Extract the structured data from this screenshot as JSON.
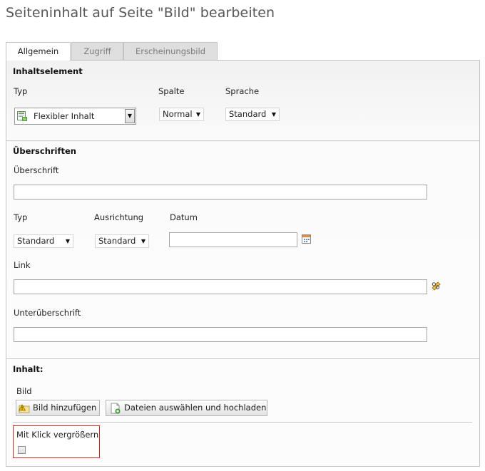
{
  "page": {
    "title": "Seiteninhalt auf Seite \"Bild\" bearbeiten"
  },
  "tabs": [
    {
      "label": "Allgemein",
      "active": true
    },
    {
      "label": "Zugriff",
      "active": false
    },
    {
      "label": "Erscheinungsbild",
      "active": false
    }
  ],
  "inhaltselement": {
    "title": "Inhaltselement",
    "typ_label": "Typ",
    "typ_value": "Flexibler Inhalt",
    "spalte_label": "Spalte",
    "spalte_value": "Normal",
    "sprache_label": "Sprache",
    "sprache_value": "Standard"
  },
  "ueberschriften": {
    "title": "Überschriften",
    "ueberschrift_label": "Überschrift",
    "ueberschrift_value": "",
    "typ_label": "Typ",
    "typ_value": "Standard",
    "ausrichtung_label": "Ausrichtung",
    "ausrichtung_value": "Standard",
    "datum_label": "Datum",
    "datum_value": "",
    "link_label": "Link",
    "link_value": "",
    "unterueberschrift_label": "Unterüberschrift",
    "unterueberschrift_value": ""
  },
  "inhalt": {
    "title": "Inhalt:",
    "bild_label": "Bild",
    "add_image_button": "Bild hinzufügen",
    "upload_button": "Dateien auswählen und hochladen",
    "zoom_label": "Mit Klick vergrößern",
    "zoom_checked": false
  },
  "icons": {
    "content_element": "flexible-content-icon",
    "calendar": "calendar-icon",
    "link_wizard": "link-wizard-icon",
    "add_image": "folder-warning-icon",
    "upload": "file-upload-icon"
  },
  "colors": {
    "highlight_border": "#d22a2a",
    "title_text": "#575757"
  }
}
